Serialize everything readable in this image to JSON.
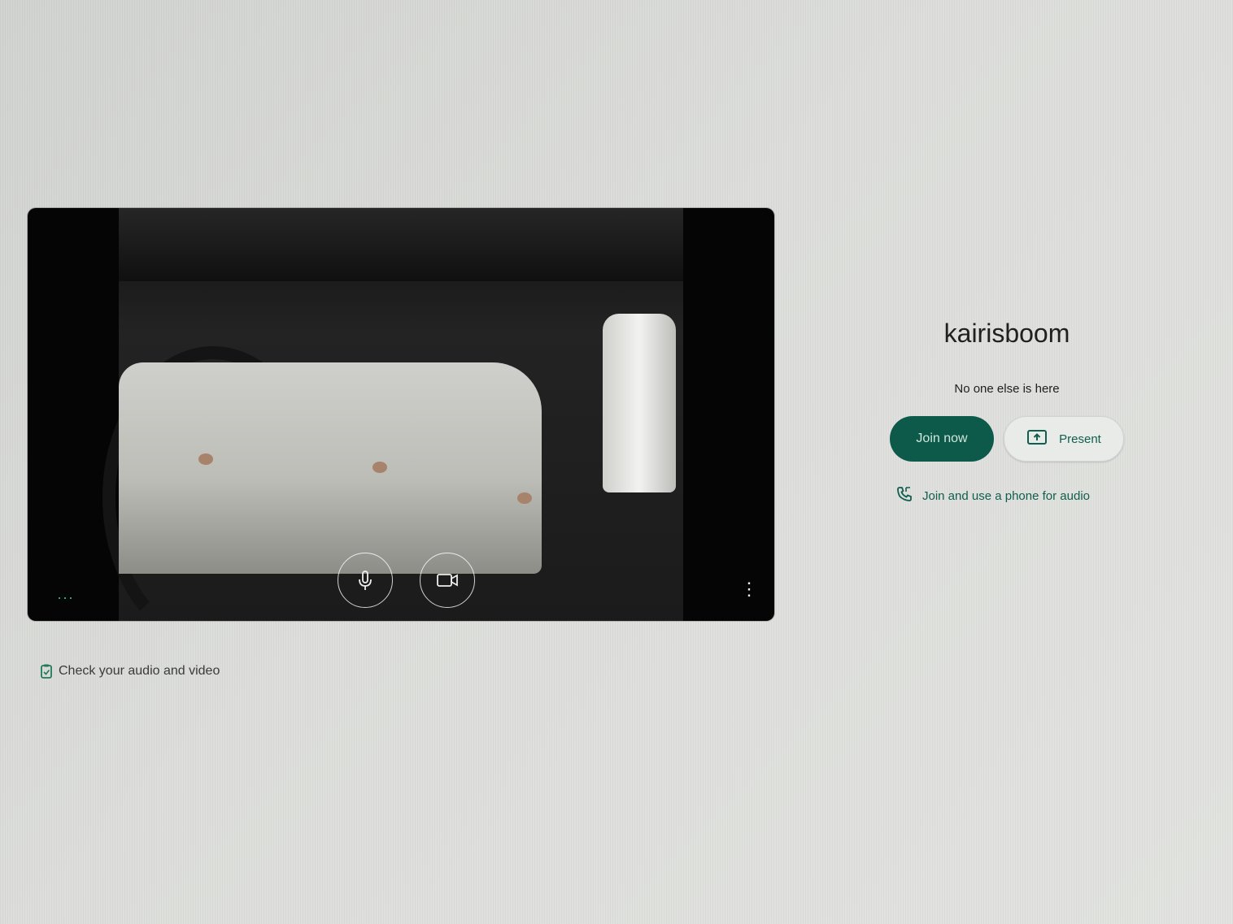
{
  "meeting": {
    "title": "kairisboom",
    "status": "No one else is here"
  },
  "actions": {
    "join_label": "Join now",
    "present_label": "Present",
    "phone_audio_label": "Join and use a phone for audio"
  },
  "preview": {
    "more_left": "···",
    "more_right": "⋮"
  },
  "footer": {
    "check_av_label": "Check your audio and video"
  },
  "colors": {
    "accent": "#0d5a4a",
    "link": "#0f5e4e",
    "more_dots": "#2fbf7a"
  },
  "icons": {
    "mic": "mic-icon",
    "camera": "camera-icon",
    "present": "present-screen-icon",
    "phone": "phone-icon",
    "check": "audio-video-check-icon"
  }
}
